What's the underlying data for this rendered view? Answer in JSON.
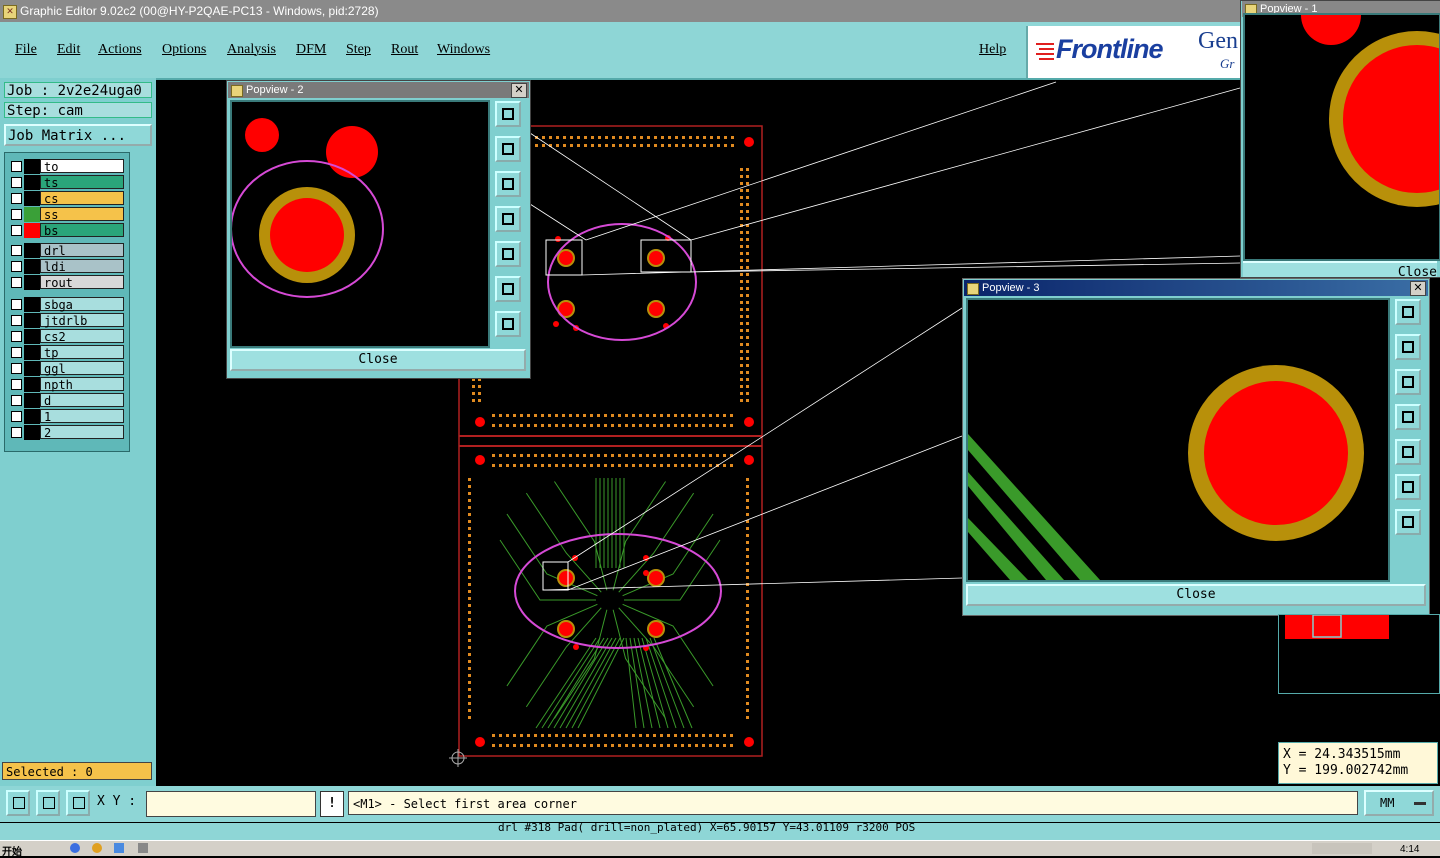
{
  "window": {
    "title": "Graphic Editor 9.02c2 (00@HY-P2QAE-PC13 - Windows, pid:2728)"
  },
  "menu": {
    "items": [
      "File",
      "Edit",
      "Actions",
      "Options",
      "Analysis",
      "DFM",
      "Step",
      "Rout",
      "Windows"
    ],
    "help": "Help"
  },
  "logo": {
    "brand": "Frontline",
    "gen": "Gen",
    "gr": "Gr"
  },
  "job": {
    "job_label": "Job : 2v2e24uga0",
    "step_label": "Step: cam",
    "matrix_button": "Job Matrix ..."
  },
  "layers": {
    "board": [
      {
        "name": "to",
        "bg": "#ffffff",
        "swatch": "#000000"
      },
      {
        "name": "ts",
        "bg": "#2aa57a",
        "swatch": "#000000"
      },
      {
        "name": "cs",
        "bg": "#f5c24a",
        "swatch": "#000000"
      },
      {
        "name": "ss",
        "bg": "#f5c24a",
        "swatch": "#3aa038"
      },
      {
        "name": "bs",
        "bg": "#2aa57a",
        "swatch": "#ff0000"
      }
    ],
    "drill": [
      {
        "name": "drl",
        "bg": "#a9c2c8",
        "swatch": "#000000"
      },
      {
        "name": "ldi",
        "bg": "#a9c2c8",
        "swatch": "#000000"
      },
      {
        "name": "rout",
        "bg": "#d8d8d8",
        "swatch": "#000000"
      }
    ],
    "misc": [
      {
        "name": "sbga",
        "bg": "#a8dede",
        "swatch": "#000000"
      },
      {
        "name": "jtdrlb",
        "bg": "#a8dede",
        "swatch": "#000000"
      },
      {
        "name": "cs2",
        "bg": "#a8dede",
        "swatch": "#000000"
      },
      {
        "name": "tp",
        "bg": "#a8dede",
        "swatch": "#000000"
      },
      {
        "name": "ggl",
        "bg": "#a8dede",
        "swatch": "#000000"
      },
      {
        "name": "npth",
        "bg": "#a8dede",
        "swatch": "#000000"
      },
      {
        "name": "d",
        "bg": "#a8dede",
        "swatch": "#000000"
      },
      {
        "name": "1",
        "bg": "#a8dede",
        "swatch": "#000000"
      },
      {
        "name": "2",
        "bg": "#a8dede",
        "swatch": "#000000"
      }
    ]
  },
  "selected": "Selected : 0",
  "popview1": {
    "title": "Popview - 1",
    "close": "Close"
  },
  "popview2": {
    "title": "Popview - 2",
    "close": "Close"
  },
  "popview3": {
    "title": "Popview - 3",
    "close": "Close"
  },
  "coords": {
    "x": "X = 24.343515mm",
    "y": "Y = 199.002742mm"
  },
  "command": {
    "xy_label": "X Y :",
    "xy_value": "",
    "excl": "!",
    "prompt": "<M1> - Select first area corner",
    "units": "MM"
  },
  "status": "drl #318 Pad( drill=non_plated) X=65.90157 Y=43.01109 r3200 POS",
  "taskbar": {
    "start": "开始",
    "clock": "4:14"
  },
  "colors": {
    "pad": "#ff0000",
    "ring": "#b8900a",
    "ellipse": "#d64ad6",
    "dots": "#e08a20",
    "trace": "#3a9a2a"
  }
}
